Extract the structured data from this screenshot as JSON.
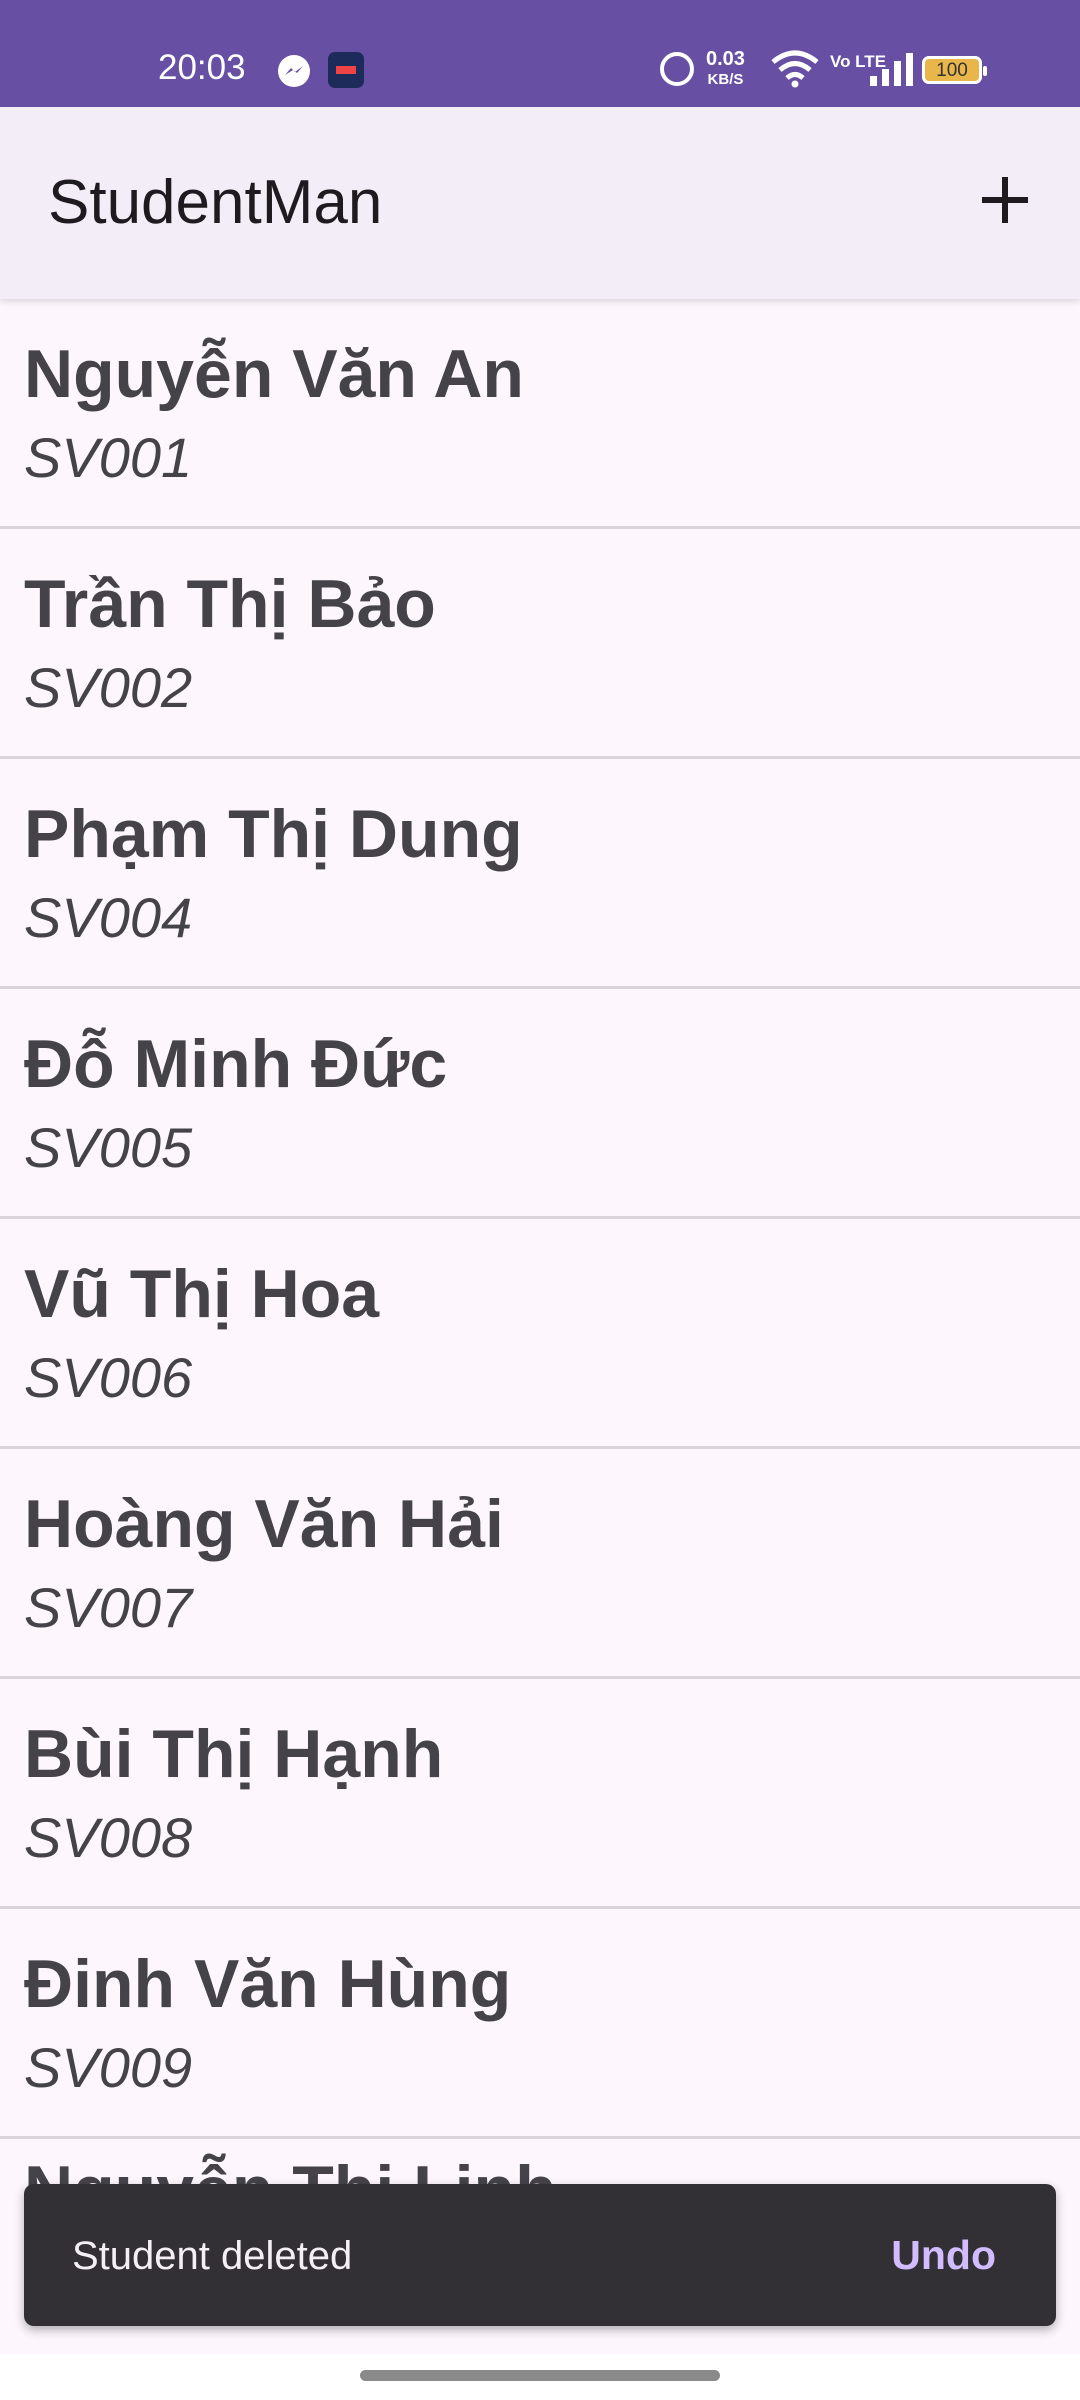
{
  "status_bar": {
    "time": "20:03",
    "net_speed_value": "0.03",
    "net_speed_unit": "KB/S",
    "volte": "Vo LTE",
    "battery": "100",
    "icons": [
      "messenger-icon",
      "app-icon",
      "alarm-icon",
      "wifi-icon",
      "signal-icon",
      "battery-icon"
    ]
  },
  "app_bar": {
    "title": "StudentMan",
    "add_icon": "plus-icon"
  },
  "students": [
    {
      "name": "Nguyễn Văn An",
      "id": "SV001"
    },
    {
      "name": "Trần Thị Bảo",
      "id": "SV002"
    },
    {
      "name": "Phạm Thị Dung",
      "id": "SV004"
    },
    {
      "name": "Đỗ Minh Đức",
      "id": "SV005"
    },
    {
      "name": "Vũ Thị Hoa",
      "id": "SV006"
    },
    {
      "name": "Hoàng Văn Hải",
      "id": "SV007"
    },
    {
      "name": "Bùi Thị Hạnh",
      "id": "SV008"
    },
    {
      "name": "Đinh Văn Hùng",
      "id": "SV009"
    }
  ],
  "partial_item": {
    "name": "Nguyễn Thị Linh"
  },
  "snackbar": {
    "message": "Student deleted",
    "action": "Undo"
  },
  "colors": {
    "status_bar": "#6750a4",
    "app_bar": "#f3edf7",
    "background": "#fdf7fd",
    "snackbar": "#322f35",
    "snackbar_action": "#d0bcff"
  }
}
